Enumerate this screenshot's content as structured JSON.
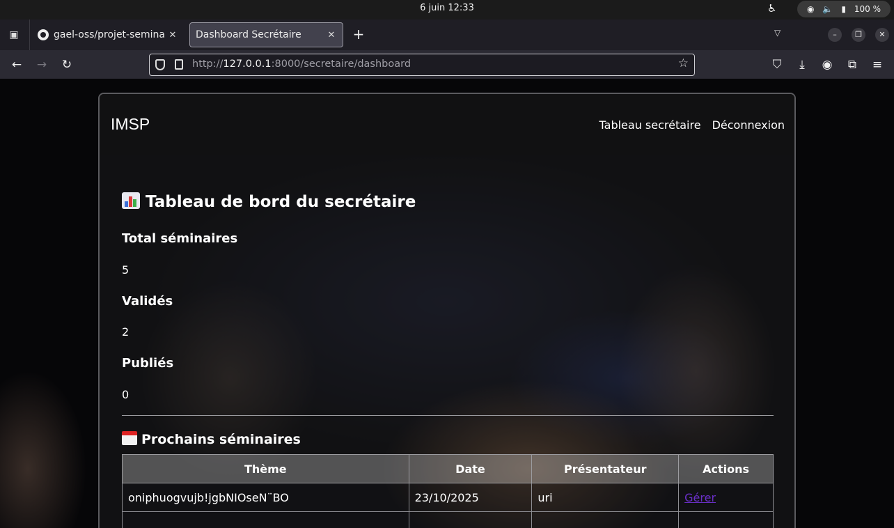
{
  "os": {
    "clock": "6 juin  12:33",
    "battery": "100 %"
  },
  "browser": {
    "tabs": [
      {
        "title": "gael-oss/projet-seminaire"
      },
      {
        "title": "Dashboard Secrétaire"
      }
    ],
    "url": {
      "scheme": "http://",
      "host": "127.0.0.1",
      "rest": ":8000/secretaire/dashboard"
    }
  },
  "site": {
    "brand": "IMSP",
    "nav": [
      "Tableau secrétaire",
      "Déconnexion"
    ]
  },
  "dashboard": {
    "title": "Tableau de bord du secrétaire",
    "stats": [
      {
        "label": "Total séminaires",
        "value": "5"
      },
      {
        "label": "Validés",
        "value": "2"
      },
      {
        "label": "Publiés",
        "value": "0"
      }
    ],
    "upcoming_title": "Prochains séminaires",
    "table": {
      "headers": [
        "Thème",
        "Date",
        "Présentateur",
        "Actions"
      ],
      "rows": [
        {
          "theme": "oniphuogvujb!jgbNIOseN¨BO",
          "date": "23/10/2025",
          "presenter": "uri",
          "action": "Gérer"
        }
      ]
    }
  },
  "colors": {
    "link_visited": "#6a2fc8",
    "chrome_dark": "#1f1e25"
  }
}
